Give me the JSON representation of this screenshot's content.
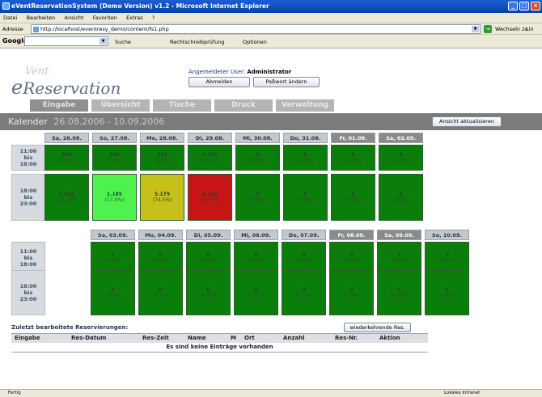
{
  "window": {
    "title": "eVentReservationSystem (Demo Version) v1.2 - Microsoft Internet Explorer"
  },
  "menu": [
    "Datei",
    "Bearbeiten",
    "Ansicht",
    "Favoriten",
    "Extras",
    "?"
  ],
  "address": {
    "label": "Adresse",
    "url": "http://localhost/eventresy_demo/content/fs1.php",
    "go_label": "Wechseln zu",
    "links_label": "Lin"
  },
  "googlebar": {
    "logo": "Google",
    "search": "Suche",
    "spell": "Rechtschreibprüfung",
    "options": "Optionen"
  },
  "header": {
    "logo_e": "e",
    "logo_vent": "Vent",
    "logo_text": "Reservation",
    "user_label": "Angemeldeter User:",
    "user_name": "Administrator",
    "logout": "Abmelden",
    "change_pw": "Paßwort ändern"
  },
  "tabs": [
    "Eingabe",
    "Übersicht",
    "Tische",
    "Druck",
    "Verwaltung"
  ],
  "calendar": {
    "label": "Kalender",
    "range": "26.08.2006 - 10.09.2006",
    "refresh": "Ansicht aktualisieren"
  },
  "colors": {
    "green": "#0b7d0b",
    "bright_green": "#4ef24e",
    "yellow": "#c7c01a",
    "red": "#c81414"
  },
  "slots": [
    {
      "from": "11:00",
      "bis": "bis",
      "to": "18:00"
    },
    {
      "from": "18:00",
      "bis": "bis",
      "to": "23:00"
    }
  ],
  "week1": {
    "days": [
      {
        "label": "Sa, 26.08.",
        "weekend": false
      },
      {
        "label": "So, 27.08.",
        "weekend": false
      },
      {
        "label": "Mo, 28.08.",
        "weekend": false
      },
      {
        "label": "Di, 29.08.",
        "weekend": false
      },
      {
        "label": "Mi, 30.08.",
        "weekend": false
      },
      {
        "label": "Do, 31.08.",
        "weekend": false
      },
      {
        "label": "Fr, 01.09.",
        "weekend": true
      },
      {
        "label": "Sa, 02.09.",
        "weekend": true
      }
    ],
    "slot1": [
      {
        "v": "600",
        "p": "(9,0%)",
        "c": "green"
      },
      {
        "v": "345",
        "p": "(5,0%)",
        "c": "green"
      },
      {
        "v": "255",
        "p": "(3,7%)",
        "c": "green"
      },
      {
        "v": "1.253",
        "p": "(18,0%)",
        "c": "green"
      },
      {
        "v": "0",
        "p": "(0,0%)",
        "c": "green"
      },
      {
        "v": "0",
        "p": "(0,0%)",
        "c": "green"
      },
      {
        "v": "0",
        "p": "(0,0%)",
        "c": "green"
      },
      {
        "v": "0",
        "p": "(0,0%)",
        "c": "green"
      }
    ],
    "slot2": [
      {
        "v": "1.472",
        "p": "(21,2%)",
        "c": "green"
      },
      {
        "v": "1.185",
        "p": "(17,0%)",
        "c": "bright_green"
      },
      {
        "v": "5.179",
        "p": "(74,5%)",
        "c": "yellow"
      },
      {
        "v": "6.333",
        "p": "(92,4%)",
        "c": "red"
      },
      {
        "v": "0",
        "p": "(0,0%)",
        "c": "green"
      },
      {
        "v": "0",
        "p": "(0,0%)",
        "c": "green"
      },
      {
        "v": "0",
        "p": "(0,0%)",
        "c": "green"
      },
      {
        "v": "0",
        "p": "(0,0%)",
        "c": "green"
      }
    ]
  },
  "week2": {
    "days": [
      {
        "label": "So, 03.09.",
        "weekend": false
      },
      {
        "label": "Mo, 04.09.",
        "weekend": false
      },
      {
        "label": "Di, 05.09.",
        "weekend": false
      },
      {
        "label": "Mi, 06.09.",
        "weekend": false
      },
      {
        "label": "Do, 07.09.",
        "weekend": false
      },
      {
        "label": "Fr, 08.09.",
        "weekend": true
      },
      {
        "label": "Sa, 09.09.",
        "weekend": true
      },
      {
        "label": "So, 10.09.",
        "weekend": false
      }
    ],
    "slot1": [
      {
        "v": "0",
        "p": "(0,0%)",
        "c": "green"
      },
      {
        "v": "0",
        "p": "(0,0%)",
        "c": "green"
      },
      {
        "v": "0",
        "p": "(0,0%)",
        "c": "green"
      },
      {
        "v": "0",
        "p": "(0,0%)",
        "c": "green"
      },
      {
        "v": "0",
        "p": "(0,0%)",
        "c": "green"
      },
      {
        "v": "0",
        "p": "(0,0%)",
        "c": "green"
      },
      {
        "v": "0",
        "p": "(0,0%)",
        "c": "green"
      },
      {
        "v": "0",
        "p": "(0,0%)",
        "c": "green"
      }
    ],
    "slot2": [
      {
        "v": "0",
        "p": "(0,0%)",
        "c": "green"
      },
      {
        "v": "0",
        "p": "(0,0%)",
        "c": "green"
      },
      {
        "v": "0",
        "p": "(0,0%)",
        "c": "green"
      },
      {
        "v": "0",
        "p": "(0,0%)",
        "c": "green"
      },
      {
        "v": "0",
        "p": "(0,0%)",
        "c": "green"
      },
      {
        "v": "0",
        "p": "(0,0%)",
        "c": "green"
      },
      {
        "v": "0",
        "p": "(0,0%)",
        "c": "green"
      },
      {
        "v": "0",
        "p": "(0,0%)",
        "c": "green"
      }
    ]
  },
  "recent": {
    "title": "Zuletzt bearbeitete Reservierungen:",
    "recurring_button": "wiederkehrende Res.",
    "columns": [
      "Eingabe",
      "Res-Datum",
      "Res-Zeit",
      "Name",
      "M",
      "Ort",
      "Anzahl",
      "Res-Nr.",
      "Aktion"
    ],
    "empty": "Es sind keine Einträge vorhanden"
  },
  "status": {
    "left": "Fertig",
    "zone": "Lokales Intranet"
  }
}
